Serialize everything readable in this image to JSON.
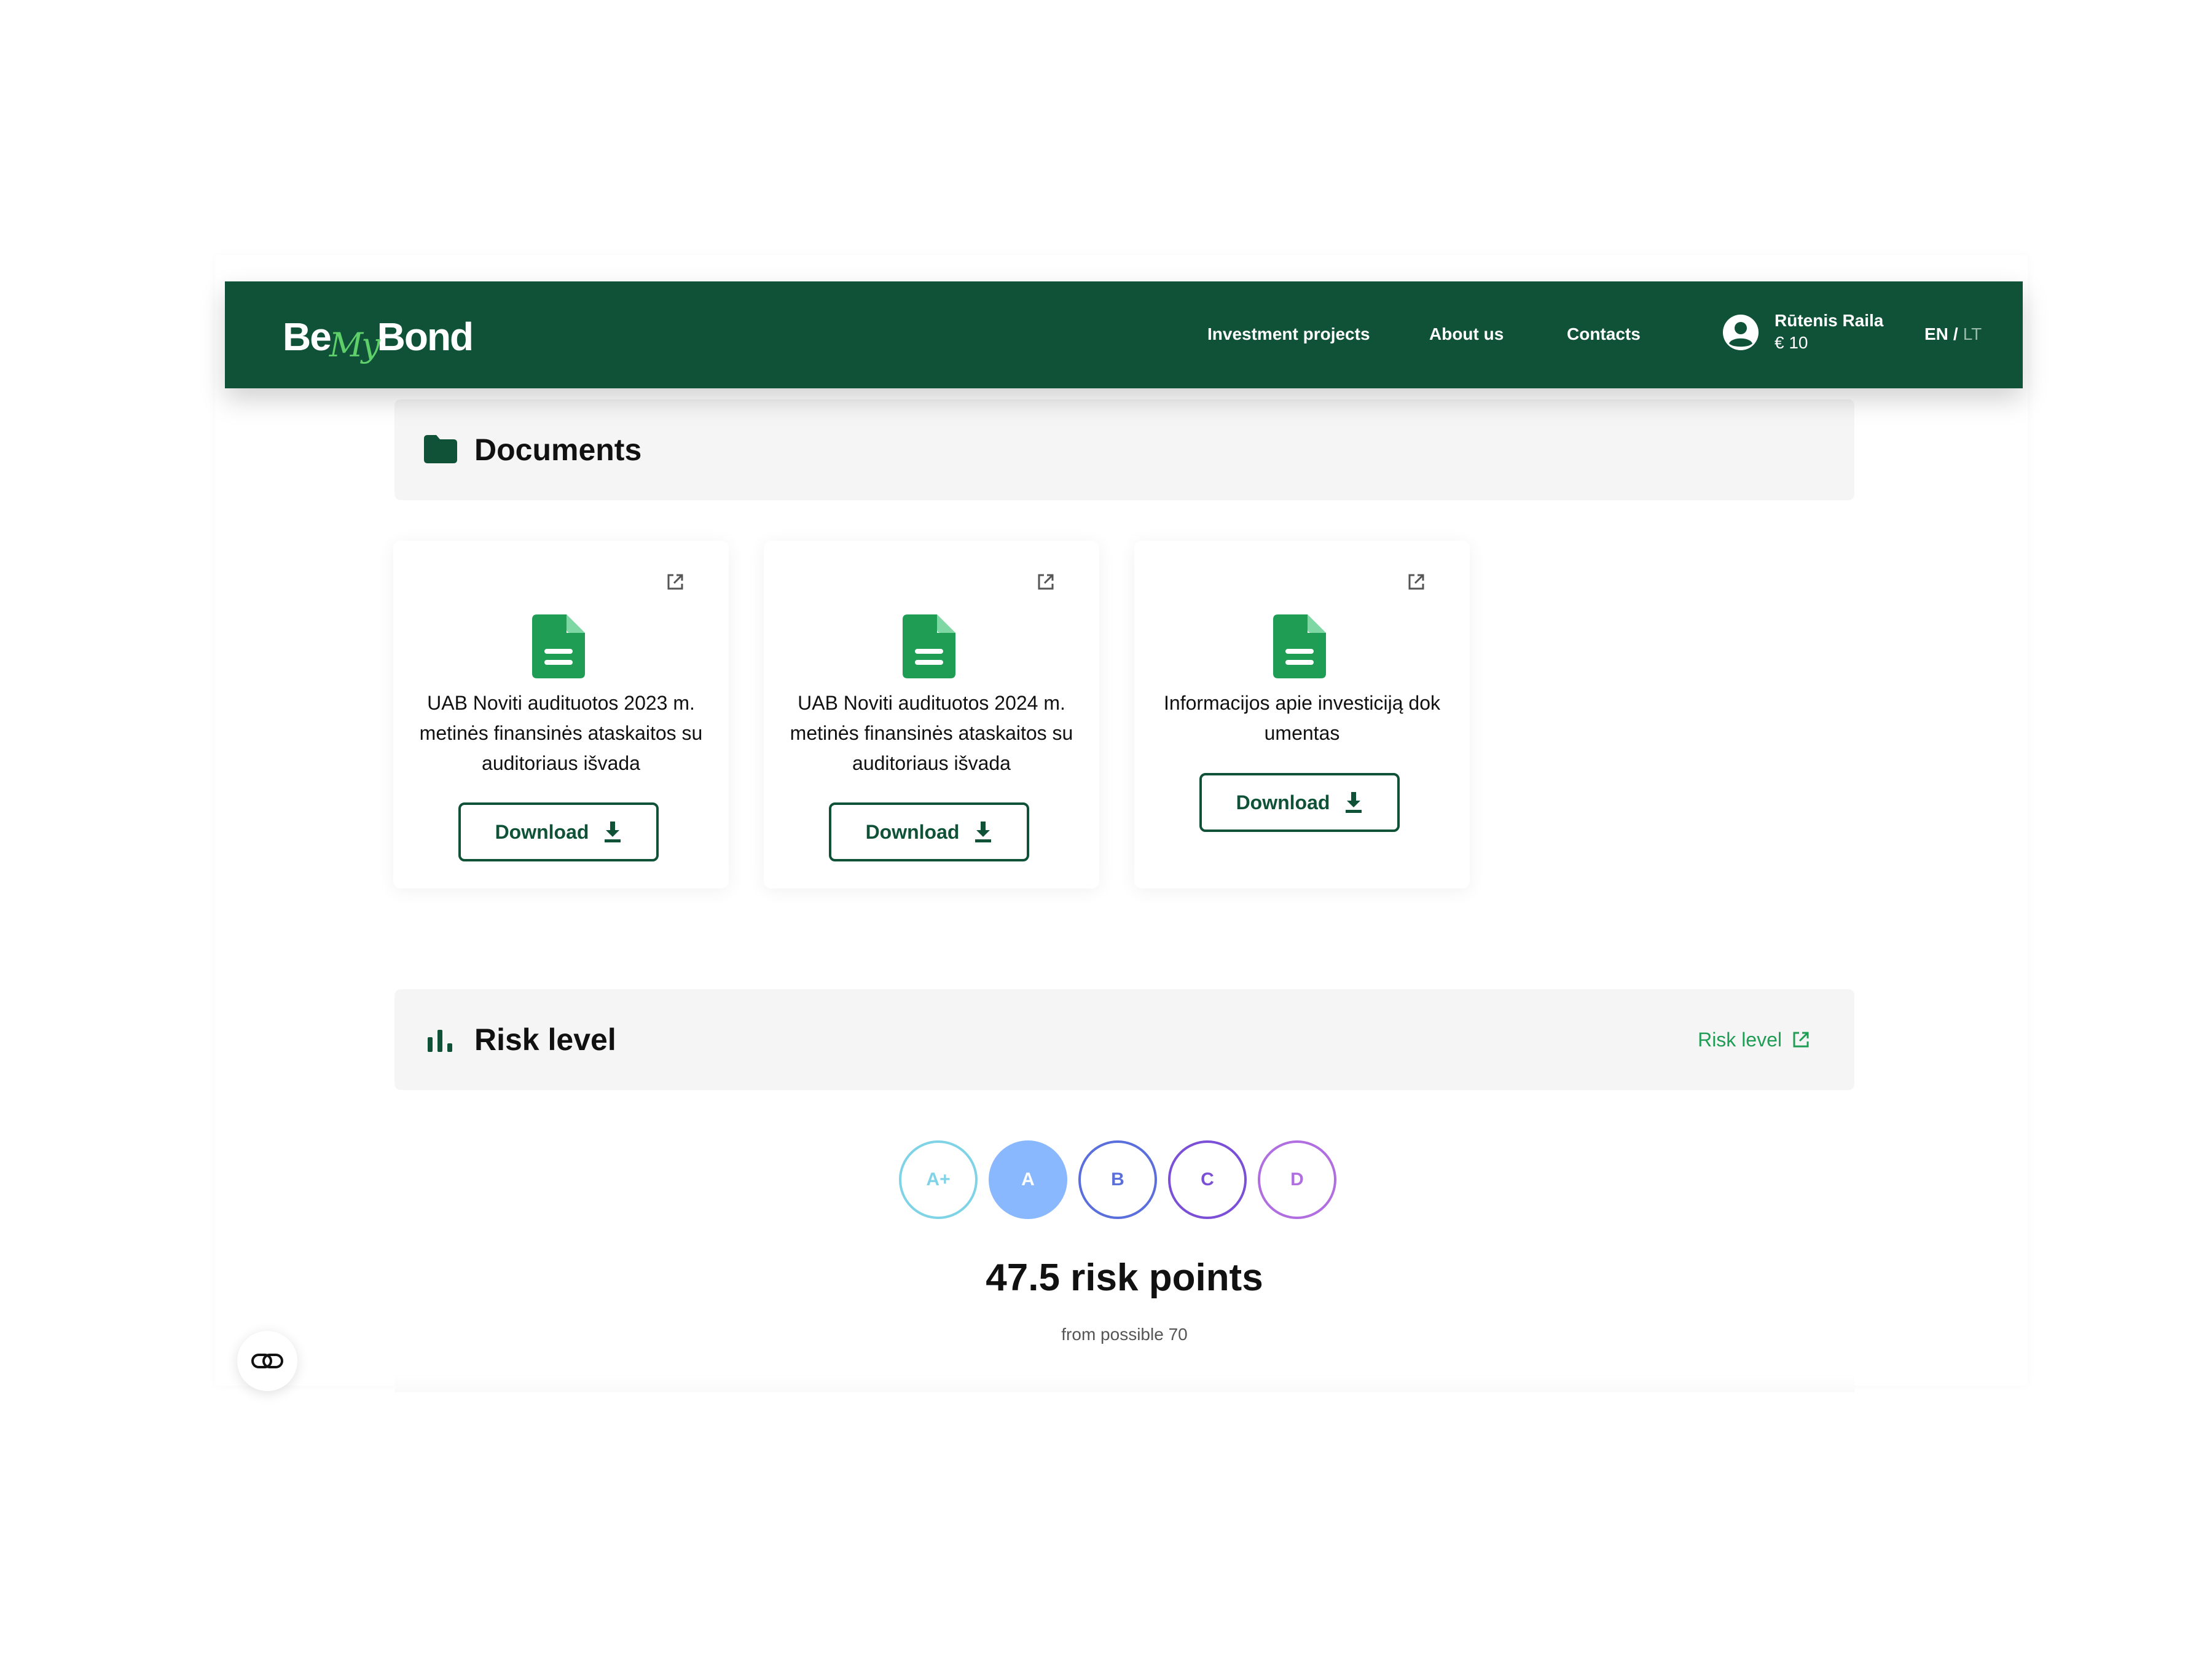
{
  "navbar": {
    "logo": {
      "part1": "Be",
      "part2": "My",
      "part3": "Bond"
    },
    "links": [
      "Investment projects",
      "About us",
      "Contacts"
    ],
    "user": {
      "name": "Rūtenis Raila",
      "balance": "€ 10"
    },
    "lang": {
      "active": "EN",
      "separator": "/",
      "other": "LT"
    },
    "background_color": "#0f5238"
  },
  "documents": {
    "title": "Documents",
    "items": [
      {
        "title": "UAB Noviti audituotos 2023 m. metinės finansinės ataskaitos su auditoriaus išvada",
        "button": "Download"
      },
      {
        "title": "UAB Noviti audituotos 2024 m. metinės finansinės ataskaitos su auditoriaus išvada",
        "button": "Download"
      },
      {
        "title": "Informacijos apie investiciją dokumentas",
        "button": "Download"
      }
    ],
    "file_icon_color": "#1f9d55"
  },
  "risk": {
    "title": "Risk level",
    "link_label": "Risk level",
    "grades": [
      {
        "label": "A+",
        "color": "#7fd3e6",
        "active": false
      },
      {
        "label": "A",
        "color": "#8ab8ff",
        "active": true
      },
      {
        "label": "B",
        "color": "#5b6fdc",
        "active": false
      },
      {
        "label": "C",
        "color": "#7b4fd6",
        "active": false
      },
      {
        "label": "D",
        "color": "#b06ee0",
        "active": false
      }
    ],
    "points_text": "47.5 risk points",
    "sub_text": "from possible 70"
  },
  "icons": {
    "folder": "folder-icon",
    "bars": "bar-chart-icon",
    "file": "file-document-icon",
    "external": "external-link-icon",
    "download": "download-arrow-icon",
    "user": "user-avatar-icon",
    "chat": "link-chat-icon"
  }
}
